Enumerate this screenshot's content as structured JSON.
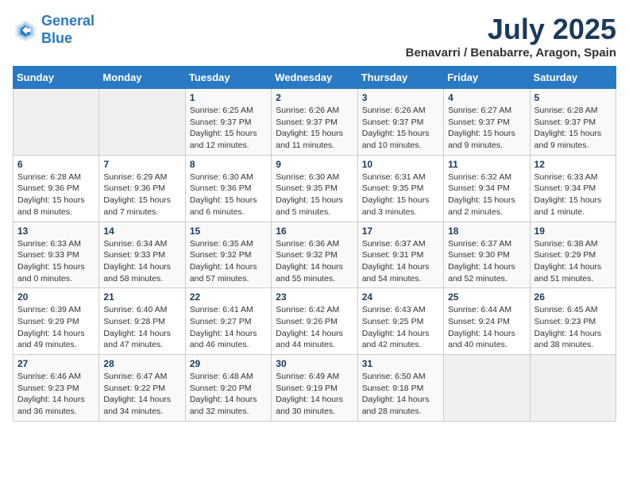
{
  "header": {
    "logo_line1": "General",
    "logo_line2": "Blue",
    "main_title": "July 2025",
    "subtitle": "Benavarri / Benabarre, Aragon, Spain"
  },
  "days_of_week": [
    "Sunday",
    "Monday",
    "Tuesday",
    "Wednesday",
    "Thursday",
    "Friday",
    "Saturday"
  ],
  "weeks": [
    [
      {
        "day": "",
        "info": ""
      },
      {
        "day": "",
        "info": ""
      },
      {
        "day": "1",
        "info": "Sunrise: 6:25 AM\nSunset: 9:37 PM\nDaylight: 15 hours and 12 minutes."
      },
      {
        "day": "2",
        "info": "Sunrise: 6:26 AM\nSunset: 9:37 PM\nDaylight: 15 hours and 11 minutes."
      },
      {
        "day": "3",
        "info": "Sunrise: 6:26 AM\nSunset: 9:37 PM\nDaylight: 15 hours and 10 minutes."
      },
      {
        "day": "4",
        "info": "Sunrise: 6:27 AM\nSunset: 9:37 PM\nDaylight: 15 hours and 9 minutes."
      },
      {
        "day": "5",
        "info": "Sunrise: 6:28 AM\nSunset: 9:37 PM\nDaylight: 15 hours and 9 minutes."
      }
    ],
    [
      {
        "day": "6",
        "info": "Sunrise: 6:28 AM\nSunset: 9:36 PM\nDaylight: 15 hours and 8 minutes."
      },
      {
        "day": "7",
        "info": "Sunrise: 6:29 AM\nSunset: 9:36 PM\nDaylight: 15 hours and 7 minutes."
      },
      {
        "day": "8",
        "info": "Sunrise: 6:30 AM\nSunset: 9:36 PM\nDaylight: 15 hours and 6 minutes."
      },
      {
        "day": "9",
        "info": "Sunrise: 6:30 AM\nSunset: 9:35 PM\nDaylight: 15 hours and 5 minutes."
      },
      {
        "day": "10",
        "info": "Sunrise: 6:31 AM\nSunset: 9:35 PM\nDaylight: 15 hours and 3 minutes."
      },
      {
        "day": "11",
        "info": "Sunrise: 6:32 AM\nSunset: 9:34 PM\nDaylight: 15 hours and 2 minutes."
      },
      {
        "day": "12",
        "info": "Sunrise: 6:33 AM\nSunset: 9:34 PM\nDaylight: 15 hours and 1 minute."
      }
    ],
    [
      {
        "day": "13",
        "info": "Sunrise: 6:33 AM\nSunset: 9:33 PM\nDaylight: 15 hours and 0 minutes."
      },
      {
        "day": "14",
        "info": "Sunrise: 6:34 AM\nSunset: 9:33 PM\nDaylight: 14 hours and 58 minutes."
      },
      {
        "day": "15",
        "info": "Sunrise: 6:35 AM\nSunset: 9:32 PM\nDaylight: 14 hours and 57 minutes."
      },
      {
        "day": "16",
        "info": "Sunrise: 6:36 AM\nSunset: 9:32 PM\nDaylight: 14 hours and 55 minutes."
      },
      {
        "day": "17",
        "info": "Sunrise: 6:37 AM\nSunset: 9:31 PM\nDaylight: 14 hours and 54 minutes."
      },
      {
        "day": "18",
        "info": "Sunrise: 6:37 AM\nSunset: 9:30 PM\nDaylight: 14 hours and 52 minutes."
      },
      {
        "day": "19",
        "info": "Sunrise: 6:38 AM\nSunset: 9:29 PM\nDaylight: 14 hours and 51 minutes."
      }
    ],
    [
      {
        "day": "20",
        "info": "Sunrise: 6:39 AM\nSunset: 9:29 PM\nDaylight: 14 hours and 49 minutes."
      },
      {
        "day": "21",
        "info": "Sunrise: 6:40 AM\nSunset: 9:28 PM\nDaylight: 14 hours and 47 minutes."
      },
      {
        "day": "22",
        "info": "Sunrise: 6:41 AM\nSunset: 9:27 PM\nDaylight: 14 hours and 46 minutes."
      },
      {
        "day": "23",
        "info": "Sunrise: 6:42 AM\nSunset: 9:26 PM\nDaylight: 14 hours and 44 minutes."
      },
      {
        "day": "24",
        "info": "Sunrise: 6:43 AM\nSunset: 9:25 PM\nDaylight: 14 hours and 42 minutes."
      },
      {
        "day": "25",
        "info": "Sunrise: 6:44 AM\nSunset: 9:24 PM\nDaylight: 14 hours and 40 minutes."
      },
      {
        "day": "26",
        "info": "Sunrise: 6:45 AM\nSunset: 9:23 PM\nDaylight: 14 hours and 38 minutes."
      }
    ],
    [
      {
        "day": "27",
        "info": "Sunrise: 6:46 AM\nSunset: 9:23 PM\nDaylight: 14 hours and 36 minutes."
      },
      {
        "day": "28",
        "info": "Sunrise: 6:47 AM\nSunset: 9:22 PM\nDaylight: 14 hours and 34 minutes."
      },
      {
        "day": "29",
        "info": "Sunrise: 6:48 AM\nSunset: 9:20 PM\nDaylight: 14 hours and 32 minutes."
      },
      {
        "day": "30",
        "info": "Sunrise: 6:49 AM\nSunset: 9:19 PM\nDaylight: 14 hours and 30 minutes."
      },
      {
        "day": "31",
        "info": "Sunrise: 6:50 AM\nSunset: 9:18 PM\nDaylight: 14 hours and 28 minutes."
      },
      {
        "day": "",
        "info": ""
      },
      {
        "day": "",
        "info": ""
      }
    ]
  ]
}
